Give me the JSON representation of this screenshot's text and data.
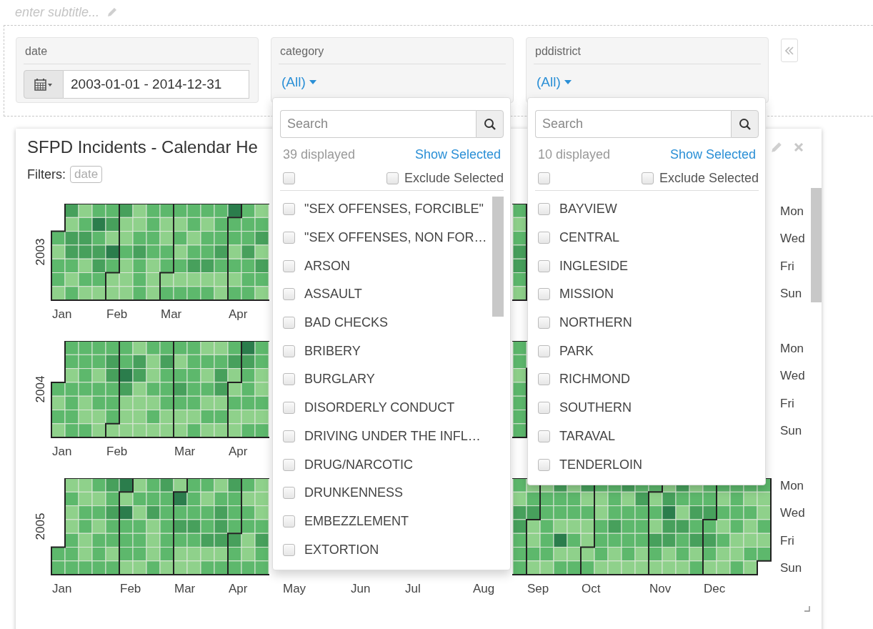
{
  "subtitle": {
    "placeholder": "enter subtitle..."
  },
  "filters": [
    {
      "kind": "date",
      "label": "date",
      "value": "2003-01-01 - 2014-12-31"
    },
    {
      "kind": "select",
      "label": "category",
      "value": "(All)",
      "dropdown": {
        "search_placeholder": "Search",
        "count": "39 displayed",
        "show_selected": "Show Selected",
        "select_all_checked": false,
        "exclude": {
          "label": "Exclude Selected",
          "checked": false
        },
        "items": [
          {
            "label": "\"SEX OFFENSES, FORCIBLE\"",
            "checked": false
          },
          {
            "label": "\"SEX OFFENSES, NON FOR…",
            "checked": false
          },
          {
            "label": "ARSON",
            "checked": false
          },
          {
            "label": "ASSAULT",
            "checked": false
          },
          {
            "label": "BAD CHECKS",
            "checked": false
          },
          {
            "label": "BRIBERY",
            "checked": false
          },
          {
            "label": "BURGLARY",
            "checked": false
          },
          {
            "label": "DISORDERLY CONDUCT",
            "checked": false
          },
          {
            "label": "DRIVING UNDER THE INFL…",
            "checked": false
          },
          {
            "label": "DRUG/NARCOTIC",
            "checked": false
          },
          {
            "label": "DRUNKENNESS",
            "checked": false
          },
          {
            "label": "EMBEZZLEMENT",
            "checked": false
          },
          {
            "label": "EXTORTION",
            "checked": false
          }
        ]
      }
    },
    {
      "kind": "select",
      "label": "pddistrict",
      "value": "(All)",
      "dropdown": {
        "search_placeholder": "Search",
        "count": "10 displayed",
        "show_selected": "Show Selected",
        "select_all_checked": false,
        "exclude": {
          "label": "Exclude Selected",
          "checked": false
        },
        "items": [
          {
            "label": "BAYVIEW",
            "checked": false
          },
          {
            "label": "CENTRAL",
            "checked": false
          },
          {
            "label": "INGLESIDE",
            "checked": false
          },
          {
            "label": "MISSION",
            "checked": false
          },
          {
            "label": "NORTHERN",
            "checked": false
          },
          {
            "label": "PARK",
            "checked": false
          },
          {
            "label": "RICHMOND",
            "checked": false
          },
          {
            "label": "SOUTHERN",
            "checked": false
          },
          {
            "label": "TARAVAL",
            "checked": false
          },
          {
            "label": "TENDERLOIN",
            "checked": false
          }
        ]
      }
    }
  ],
  "chart": {
    "title": "SFPD Incidents - Calendar He",
    "filters_label": "Filters:",
    "filter_tags": [
      "date"
    ],
    "years": [
      {
        "year": "2003",
        "months": [
          "Jan",
          "Feb",
          "Mar",
          "Apr"
        ],
        "days": [
          "Mon",
          "Wed",
          "Fri",
          "Sun"
        ]
      },
      {
        "year": "2004",
        "months": [
          "Jan",
          "Feb",
          "Mar",
          "Apr"
        ],
        "days": [
          "Mon",
          "Wed",
          "Fri",
          "Sun"
        ]
      },
      {
        "year": "2005",
        "months": [
          "Jan",
          "Feb",
          "Mar",
          "Apr",
          "May",
          "Jun",
          "Jul",
          "Aug",
          "Sep",
          "Oct",
          "Nov",
          "Dec"
        ],
        "days": [
          "Mon",
          "Wed",
          "Fri",
          "Sun"
        ]
      }
    ]
  }
}
